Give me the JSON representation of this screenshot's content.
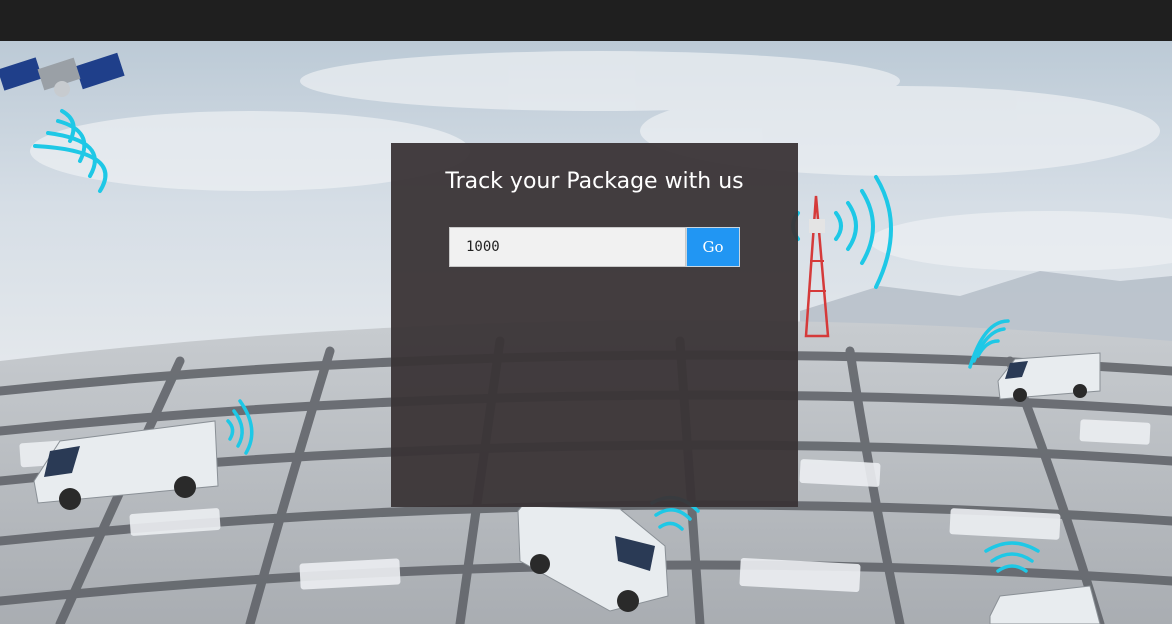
{
  "header": {},
  "hero": {
    "title": "Track your Package with us",
    "tracking_input_value": "1000",
    "go_label": "Go"
  },
  "colors": {
    "topbar": "#1f1f1f",
    "panel": "#3a3436",
    "go_button": "#2196f3",
    "signal": "#1ec8e6"
  },
  "icons": [
    "satellite-icon",
    "cell-tower-icon",
    "delivery-van-icon",
    "signal-waves-icon"
  ]
}
